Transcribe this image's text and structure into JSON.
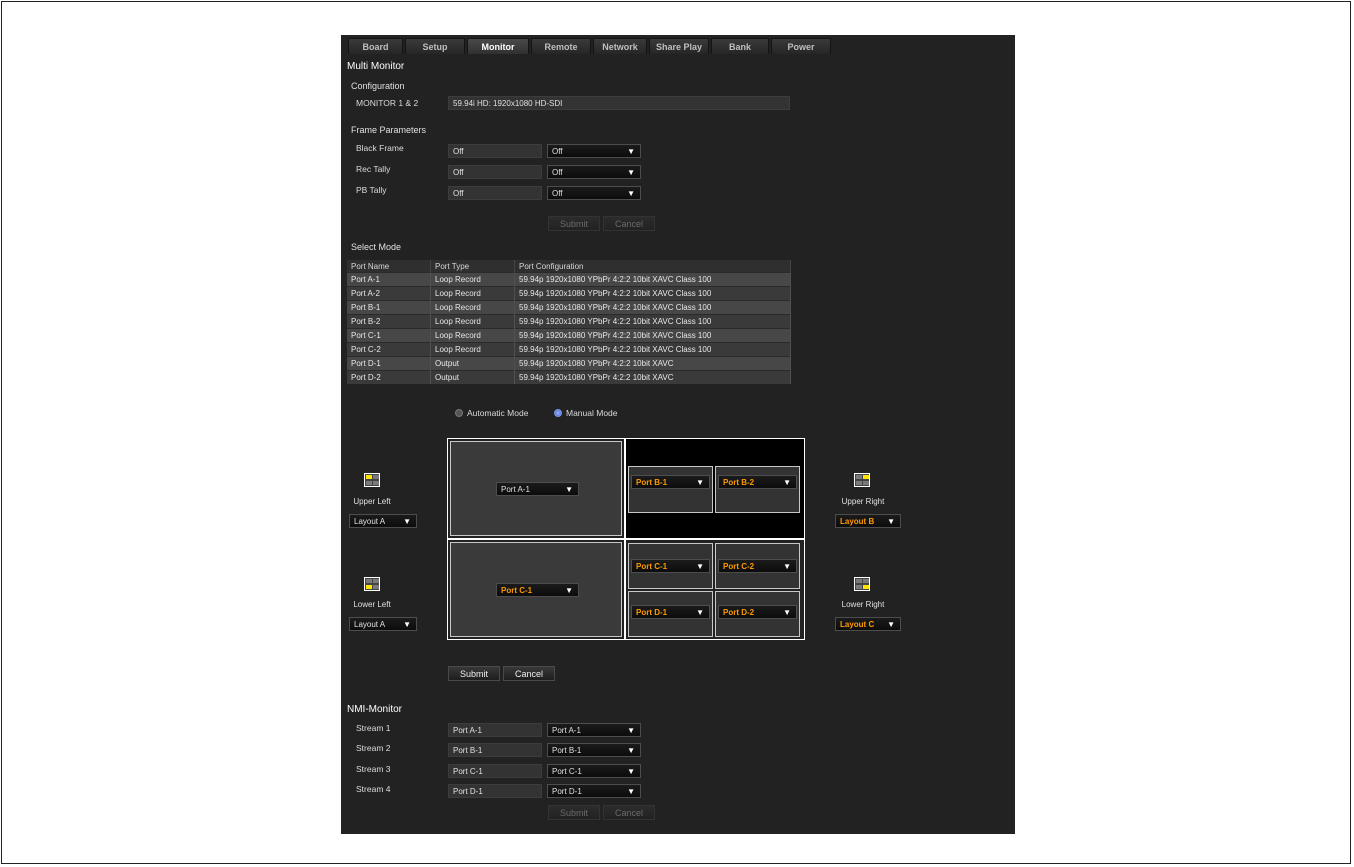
{
  "tabs": [
    "Board",
    "Setup",
    "Monitor",
    "Remote",
    "Network",
    "Share Play",
    "Bank",
    "Power"
  ],
  "active_tab": "Monitor",
  "multi_monitor": {
    "title": "Multi Monitor",
    "configuration": {
      "title": "Configuration",
      "label": "MONITOR 1 & 2",
      "value": "59.94i HD: 1920x1080 HD-SDI"
    },
    "frame_parameters": {
      "title": "Frame Parameters",
      "rows": [
        {
          "label": "Black Frame",
          "current": "Off",
          "selected": "Off"
        },
        {
          "label": "Rec Tally",
          "current": "Off",
          "selected": "Off"
        },
        {
          "label": "PB Tally",
          "current": "Off",
          "selected": "Off"
        }
      ],
      "submit": "Submit",
      "cancel": "Cancel"
    },
    "select_mode": {
      "title": "Select Mode",
      "columns": [
        "Port Name",
        "Port Type",
        "Port Configuration"
      ],
      "rows": [
        [
          "Port A-1",
          "Loop Record",
          "59.94p 1920x1080 YPbPr 4:2:2 10bit XAVC Class 100"
        ],
        [
          "Port A-2",
          "Loop Record",
          "59.94p 1920x1080 YPbPr 4:2:2 10bit XAVC Class 100"
        ],
        [
          "Port B-1",
          "Loop Record",
          "59.94p 1920x1080 YPbPr 4:2:2 10bit XAVC Class 100"
        ],
        [
          "Port B-2",
          "Loop Record",
          "59.94p 1920x1080 YPbPr 4:2:2 10bit XAVC Class 100"
        ],
        [
          "Port C-1",
          "Loop Record",
          "59.94p 1920x1080 YPbPr 4:2:2 10bit XAVC Class 100"
        ],
        [
          "Port C-2",
          "Loop Record",
          "59.94p 1920x1080 YPbPr 4:2:2 10bit XAVC Class 100"
        ],
        [
          "Port D-1",
          "Output",
          "59.94p 1920x1080 YPbPr 4:2:2 10bit XAVC"
        ],
        [
          "Port D-2",
          "Output",
          "59.94p 1920x1080 YPbPr 4:2:2 10bit XAVC"
        ]
      ],
      "automatic_mode": "Automatic Mode",
      "manual_mode": "Manual Mode",
      "selected_mode": "Manual Mode"
    },
    "layout": {
      "upper_left": {
        "label": "Upper Left",
        "layout": "Layout A",
        "port": "Port A-1"
      },
      "upper_right": {
        "label": "Upper Right",
        "layout": "Layout B",
        "ports": [
          "Port B-1",
          "Port B-2"
        ]
      },
      "lower_left": {
        "label": "Lower Left",
        "layout": "Layout A",
        "port": "Port C-1"
      },
      "lower_right": {
        "label": "Lower Right",
        "layout": "Layout C",
        "ports": [
          "Port C-1",
          "Port C-2",
          "Port D-1",
          "Port D-2"
        ]
      },
      "submit": "Submit",
      "cancel": "Cancel"
    }
  },
  "nmi_monitor": {
    "title": "NMI-Monitor",
    "streams": [
      {
        "label": "Stream 1",
        "current": "Port A-1",
        "selected": "Port A-1"
      },
      {
        "label": "Stream 2",
        "current": "Port B-1",
        "selected": "Port B-1"
      },
      {
        "label": "Stream 3",
        "current": "Port C-1",
        "selected": "Port C-1"
      },
      {
        "label": "Stream 4",
        "current": "Port D-1",
        "selected": "Port D-1"
      }
    ],
    "submit": "Submit",
    "cancel": "Cancel"
  },
  "colors": {
    "background": "#222222",
    "accent_orange": "#ff9a00",
    "yellow": "#ffe600",
    "radio_selected": "#4a6fd8"
  },
  "icons": {
    "dropdown": "triangle-down-icon"
  }
}
